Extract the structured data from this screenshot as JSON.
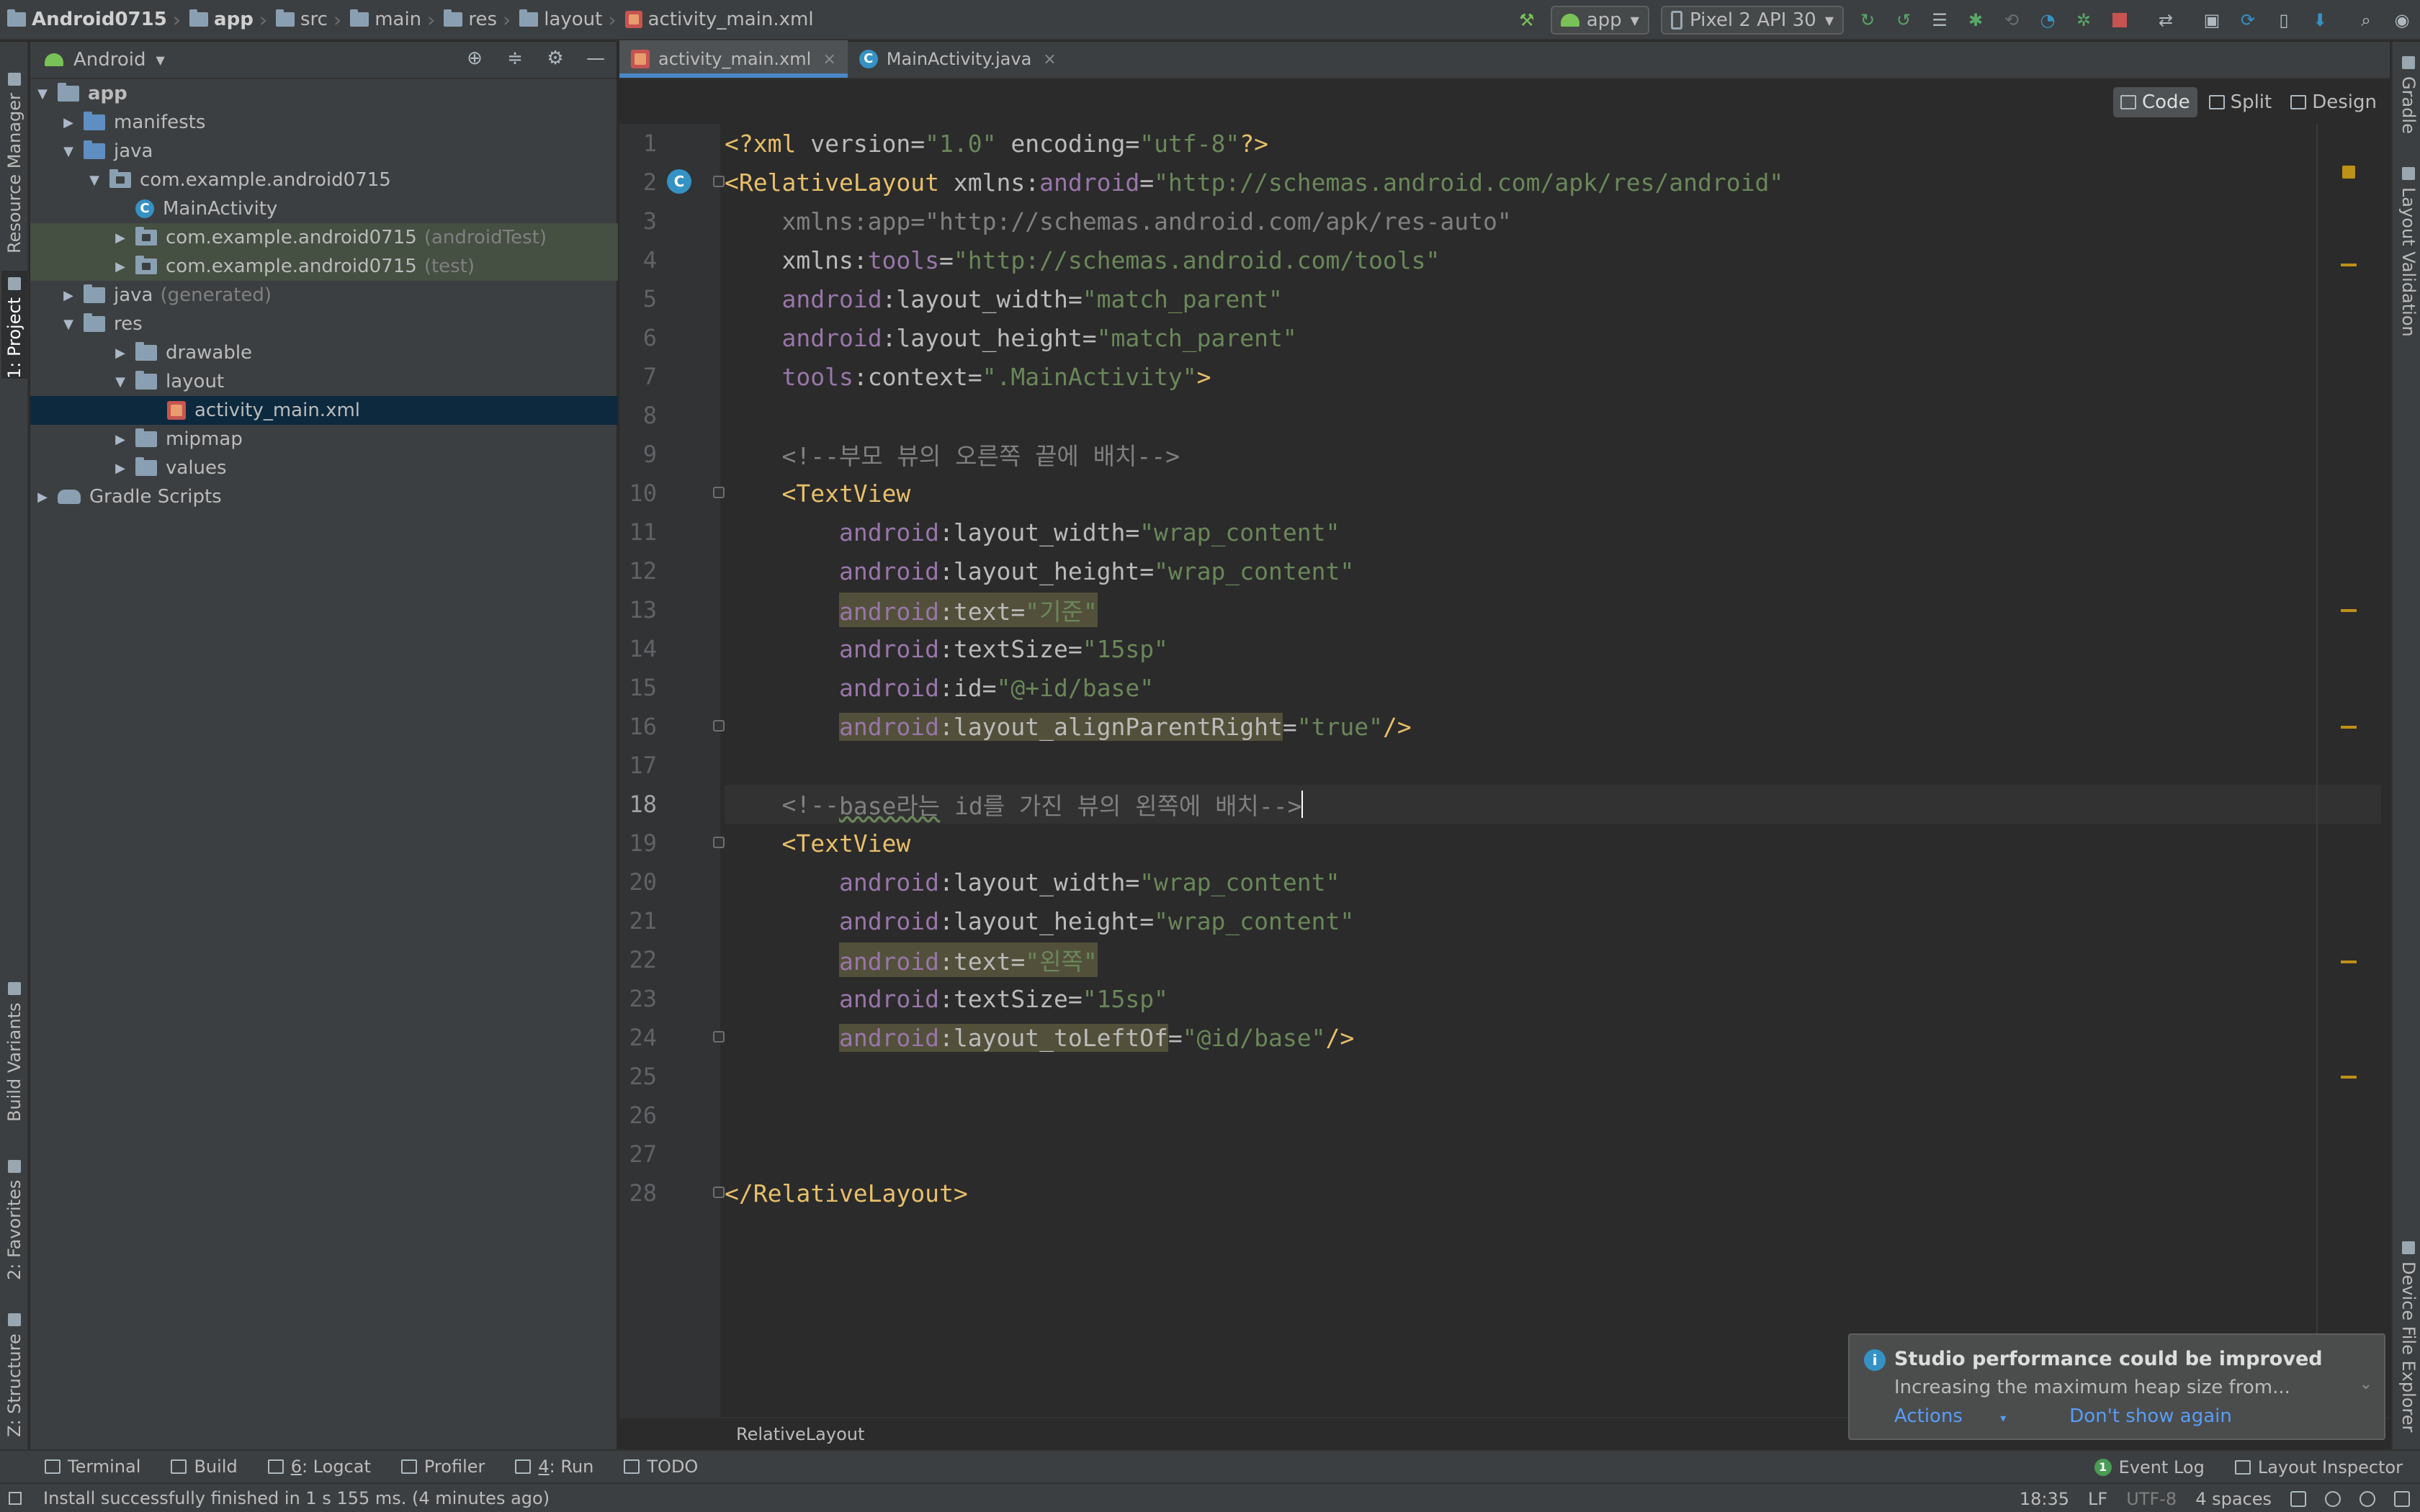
{
  "breadcrumb": [
    "Android0715",
    "app",
    "src",
    "main",
    "res",
    "layout",
    "activity_main.xml"
  ],
  "toolbar": {
    "run_config": "app",
    "device": "Pixel 2 API 30"
  },
  "left_tool_tabs": [
    "Resource Manager",
    "1: Project",
    "Build Variants",
    "2: Favorites",
    "Z: Structure"
  ],
  "right_tool_tabs": [
    "Gradle",
    "Layout Validation",
    "Device File Explorer"
  ],
  "project_panel": {
    "view_label": "Android",
    "tree": [
      {
        "label": "app",
        "hint": ""
      },
      {
        "label": "manifests",
        "hint": ""
      },
      {
        "label": "java",
        "hint": ""
      },
      {
        "label": "com.example.android0715",
        "hint": ""
      },
      {
        "label": "MainActivity",
        "hint": ""
      },
      {
        "label": "com.example.android0715",
        "hint": "(androidTest)"
      },
      {
        "label": "com.example.android0715",
        "hint": "(test)"
      },
      {
        "label": "java",
        "hint": "(generated)"
      },
      {
        "label": "res",
        "hint": ""
      },
      {
        "label": "drawable",
        "hint": ""
      },
      {
        "label": "layout",
        "hint": ""
      },
      {
        "label": "activity_main.xml",
        "hint": ""
      },
      {
        "label": "mipmap",
        "hint": ""
      },
      {
        "label": "values",
        "hint": ""
      },
      {
        "label": "Gradle Scripts",
        "hint": ""
      }
    ]
  },
  "editor": {
    "tabs": [
      {
        "label": "activity_main.xml",
        "active": true
      },
      {
        "label": "MainActivity.java",
        "active": false
      }
    ],
    "modes": [
      "Code",
      "Split",
      "Design"
    ],
    "active_mode": "Code",
    "current_line": 18,
    "line_numbers": [
      "1",
      "2",
      "3",
      "4",
      "5",
      "6",
      "7",
      "8",
      "9",
      "10",
      "11",
      "12",
      "13",
      "14",
      "15",
      "16",
      "17",
      "18",
      "19",
      "20",
      "21",
      "22",
      "23",
      "24",
      "25",
      "26",
      "27",
      "28"
    ],
    "code": {
      "l1": [
        "<?xml",
        " version",
        "=",
        "\"1.0\"",
        " encoding",
        "=",
        "\"utf-8\"",
        "?>"
      ],
      "l2": [
        "<RelativeLayout",
        " xmlns",
        ":",
        "android",
        "=",
        "\"http://schemas.android.com/apk/res/android\""
      ],
      "l3": [
        "    xmlns:app",
        "=",
        "\"http://schemas.android.com/apk/res-auto\""
      ],
      "l4": [
        "    xmlns:",
        "tools",
        "=",
        "\"http://schemas.android.com/tools\""
      ],
      "l5": [
        "    ",
        "android",
        ":layout_width",
        "=",
        "\"match_parent\""
      ],
      "l6": [
        "    ",
        "android",
        ":layout_height",
        "=",
        "\"match_parent\""
      ],
      "l7": [
        "    ",
        "tools",
        ":context",
        "=",
        "\".MainActivity\"",
        ">"
      ],
      "l9": "    <!--부모 뷰의 오른쪽 끝에 배치-->",
      "l10": "    <TextView",
      "l11": [
        "        ",
        "android",
        ":layout_width",
        "=",
        "\"wrap_content\""
      ],
      "l12": [
        "        ",
        "android",
        ":layout_height",
        "=",
        "\"wrap_content\""
      ],
      "l13": [
        "        ",
        "android",
        ":text",
        "=",
        "\"기준\""
      ],
      "l14": [
        "        ",
        "android",
        ":textSize",
        "=",
        "\"15sp\""
      ],
      "l15": [
        "        ",
        "android",
        ":id",
        "=",
        "\"@+id/base\""
      ],
      "l16": [
        "        ",
        "android",
        ":layout_alignParentRight",
        "=",
        "\"true\"",
        "/>"
      ],
      "l18": [
        "    <!--",
        "base라는",
        " id를 가진 뷰의 왼쪽에 배치-->"
      ],
      "l19": "    <TextView",
      "l20": [
        "        ",
        "android",
        ":layout_width",
        "=",
        "\"wrap_content\""
      ],
      "l21": [
        "        ",
        "android",
        ":layout_height",
        "=",
        "\"wrap_content\""
      ],
      "l22": [
        "        ",
        "android",
        ":text",
        "=",
        "\"왼쪽\""
      ],
      "l23": [
        "        ",
        "android",
        ":textSize",
        "=",
        "\"15sp\""
      ],
      "l24": [
        "        ",
        "android",
        ":layout_toLeftOf",
        "=",
        "\"@id/base\"",
        "/>"
      ],
      "l28": "</RelativeLayout>"
    },
    "structure_breadcrumb": "RelativeLayout"
  },
  "notification": {
    "title": "Studio performance could be improved",
    "body": "Increasing the maximum heap size from...",
    "action_1": "Actions",
    "action_2": "Don't show again"
  },
  "bottom_tools": {
    "terminal": "Terminal",
    "build": "Build",
    "logcat_num": "6",
    "logcat": ": Logcat",
    "profiler": "Profiler",
    "run_num": "4",
    "run": ": Run",
    "todo": "TODO",
    "event_log": "Event Log",
    "layout_inspector": "Layout Inspector"
  },
  "status_bar": {
    "message": "Install successfully finished in 1 s 155 ms. (4 minutes ago)",
    "time": "18:35",
    "line_sep": "LF",
    "encoding": "UTF-8",
    "indent": "4 spaces"
  },
  "colors": {
    "tag": "#e8bf6a",
    "namespace": "#9876aa",
    "string": "#6a8759",
    "comment": "#808080",
    "accent": "#4a88c7"
  }
}
